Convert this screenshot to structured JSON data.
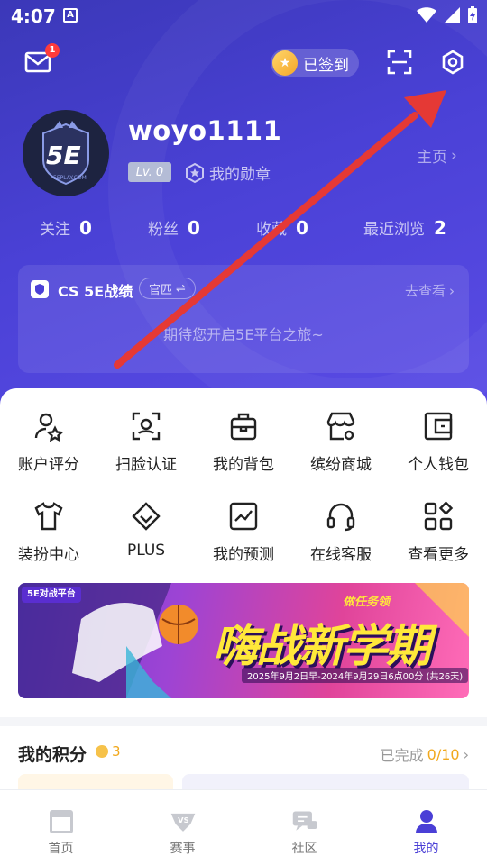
{
  "status_bar": {
    "time": "4:07",
    "notif": "A"
  },
  "header": {
    "mail_badge": "1",
    "signin_label": "已签到"
  },
  "profile": {
    "avatar_text": "5E",
    "avatar_subtext": "5EPLAY.COM",
    "username": "woyo1111",
    "level": "Lv. 0",
    "medal_label": "我的勋章",
    "homepage_label": "主页"
  },
  "stats": [
    {
      "label": "关注",
      "value": "0"
    },
    {
      "label": "粉丝",
      "value": "0"
    },
    {
      "label": "收藏",
      "value": "0"
    },
    {
      "label": "最近浏览",
      "value": "2"
    }
  ],
  "cs_card": {
    "title": "CS 5E战绩",
    "mode": "官匹",
    "go_label": "去查看",
    "empty_text": "期待您开启5E平台之旅~"
  },
  "menu": [
    {
      "label": "账户评分",
      "icon": "user-star-icon"
    },
    {
      "label": "扫脸认证",
      "icon": "face-scan-icon"
    },
    {
      "label": "我的背包",
      "icon": "backpack-icon"
    },
    {
      "label": "缤纷商城",
      "icon": "store-icon"
    },
    {
      "label": "个人钱包",
      "icon": "wallet-icon"
    },
    {
      "label": "装扮中心",
      "icon": "shirt-icon"
    },
    {
      "label": "PLUS",
      "icon": "diamond-icon"
    },
    {
      "label": "我的预测",
      "icon": "chart-icon"
    },
    {
      "label": "在线客服",
      "icon": "headset-icon"
    },
    {
      "label": "查看更多",
      "icon": "apps-icon"
    }
  ],
  "banner": {
    "tag": "5E对战平台",
    "title": "嗨战新学期",
    "subtitle": "做任务领",
    "date": "2025年9月2日早-2024年9月29日6点00分 (共26天)"
  },
  "points": {
    "title": "我的积分",
    "value": "3",
    "done_label": "已完成",
    "done_value": "0/10"
  },
  "tabbar": [
    {
      "label": "首页",
      "icon": "home-icon"
    },
    {
      "label": "赛事",
      "icon": "vs-icon"
    },
    {
      "label": "社区",
      "icon": "chat-icon"
    },
    {
      "label": "我的",
      "icon": "profile-icon"
    }
  ],
  "colors": {
    "accent": "#4a3fd6",
    "hero": "#4a41d6",
    "annotation_arrow": "#e53935",
    "points": "#f1a81c"
  }
}
